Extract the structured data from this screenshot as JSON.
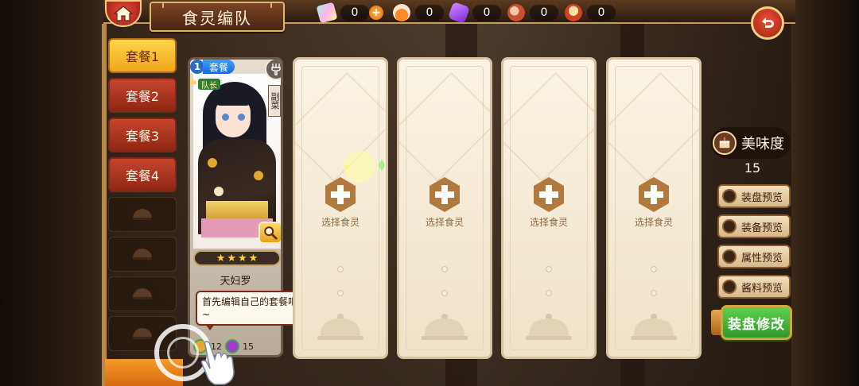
{
  "header": {
    "title": "食灵编队"
  },
  "resources": [
    {
      "icon": "rainbow-crystal-icon",
      "value": "0",
      "has_plus": true
    },
    {
      "icon": "potion-bottle-icon",
      "value": "0",
      "has_plus": false
    },
    {
      "icon": "purple-gem-icon",
      "value": "0",
      "has_plus": false
    },
    {
      "icon": "meat-icon",
      "value": "0",
      "has_plus": false
    },
    {
      "icon": "drum-icon",
      "value": "0",
      "has_plus": false
    }
  ],
  "sets": [
    {
      "label": "套餐1",
      "active": true
    },
    {
      "label": "套餐2",
      "active": false
    },
    {
      "label": "套餐3",
      "active": false
    },
    {
      "label": "套餐4",
      "active": false
    }
  ],
  "hero": {
    "level": "1",
    "type": "套餐",
    "leader": "队长",
    "side_tag": "副菜",
    "stars": 4,
    "name": "天妇罗",
    "stat_a": "12",
    "stat_b": "15"
  },
  "tooltip": {
    "text": "首先编辑自己的套餐吧~"
  },
  "slots": [
    {
      "label": "选择食灵"
    },
    {
      "label": "选择食灵"
    },
    {
      "label": "选择食灵"
    },
    {
      "label": "选择食灵"
    }
  ],
  "taste": {
    "label": "美味度",
    "value": "15"
  },
  "previews": [
    {
      "label": "装盘预览"
    },
    {
      "label": "装备预览"
    },
    {
      "label": "属性预览"
    },
    {
      "label": "酱料预览"
    }
  ],
  "actions": {
    "edit_plate": "装盘修改"
  },
  "colors": {
    "accent_gold": "#f3cf83",
    "tab_red": "#c6452d",
    "tab_active": "#ffd54a",
    "edit_green": "#5fd04e"
  }
}
